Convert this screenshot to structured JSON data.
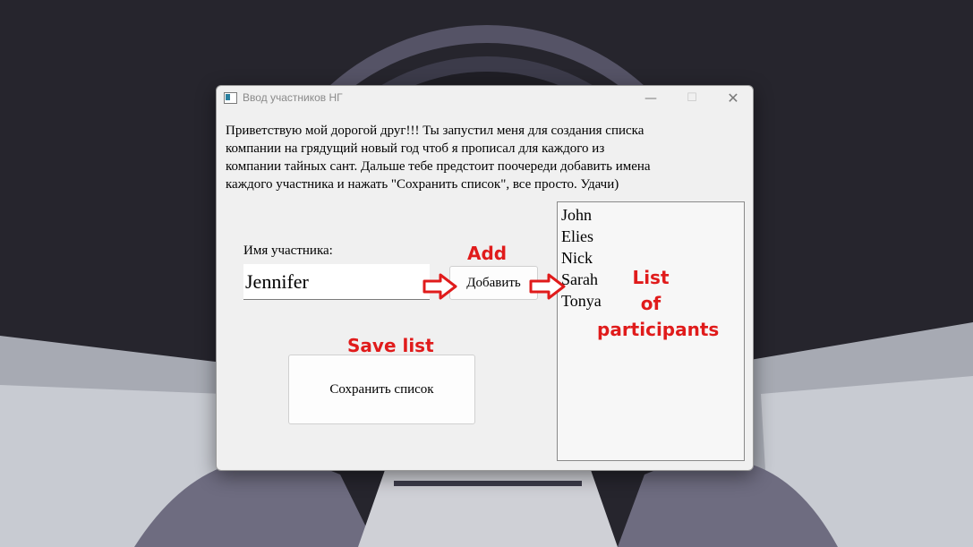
{
  "window": {
    "title": "Ввод участников НГ",
    "minimize_glyph": "—",
    "maximize_glyph": "☐",
    "close_glyph": "✕"
  },
  "intro_text": "Приветствую мой дорогой друг!!! Ты запустил меня для создания списка\nкомпании на грядущий новый год чтоб я прописал для каждого из\nкомпании тайных сант. Дальше тебе предстоит поочереди добавить имена\nкаждого участника и нажать \"Сохранить список\", все просто. Удачи)",
  "form": {
    "name_label": "Имя участника:",
    "name_value": "Jennifer",
    "add_button": "Добавить",
    "save_button": "Сохранить список"
  },
  "participants": [
    "John",
    "Elies",
    "Nick",
    "Sarah",
    "Tonya"
  ],
  "annotations": {
    "add": "Add",
    "save_list": "Save list",
    "list_line1": "List",
    "list_line2": "of",
    "list_line3": "participants",
    "color": "#e01b1b"
  },
  "icons": [
    "app-icon",
    "minimize-icon",
    "maximize-icon",
    "close-icon",
    "arrow-right-icon"
  ]
}
